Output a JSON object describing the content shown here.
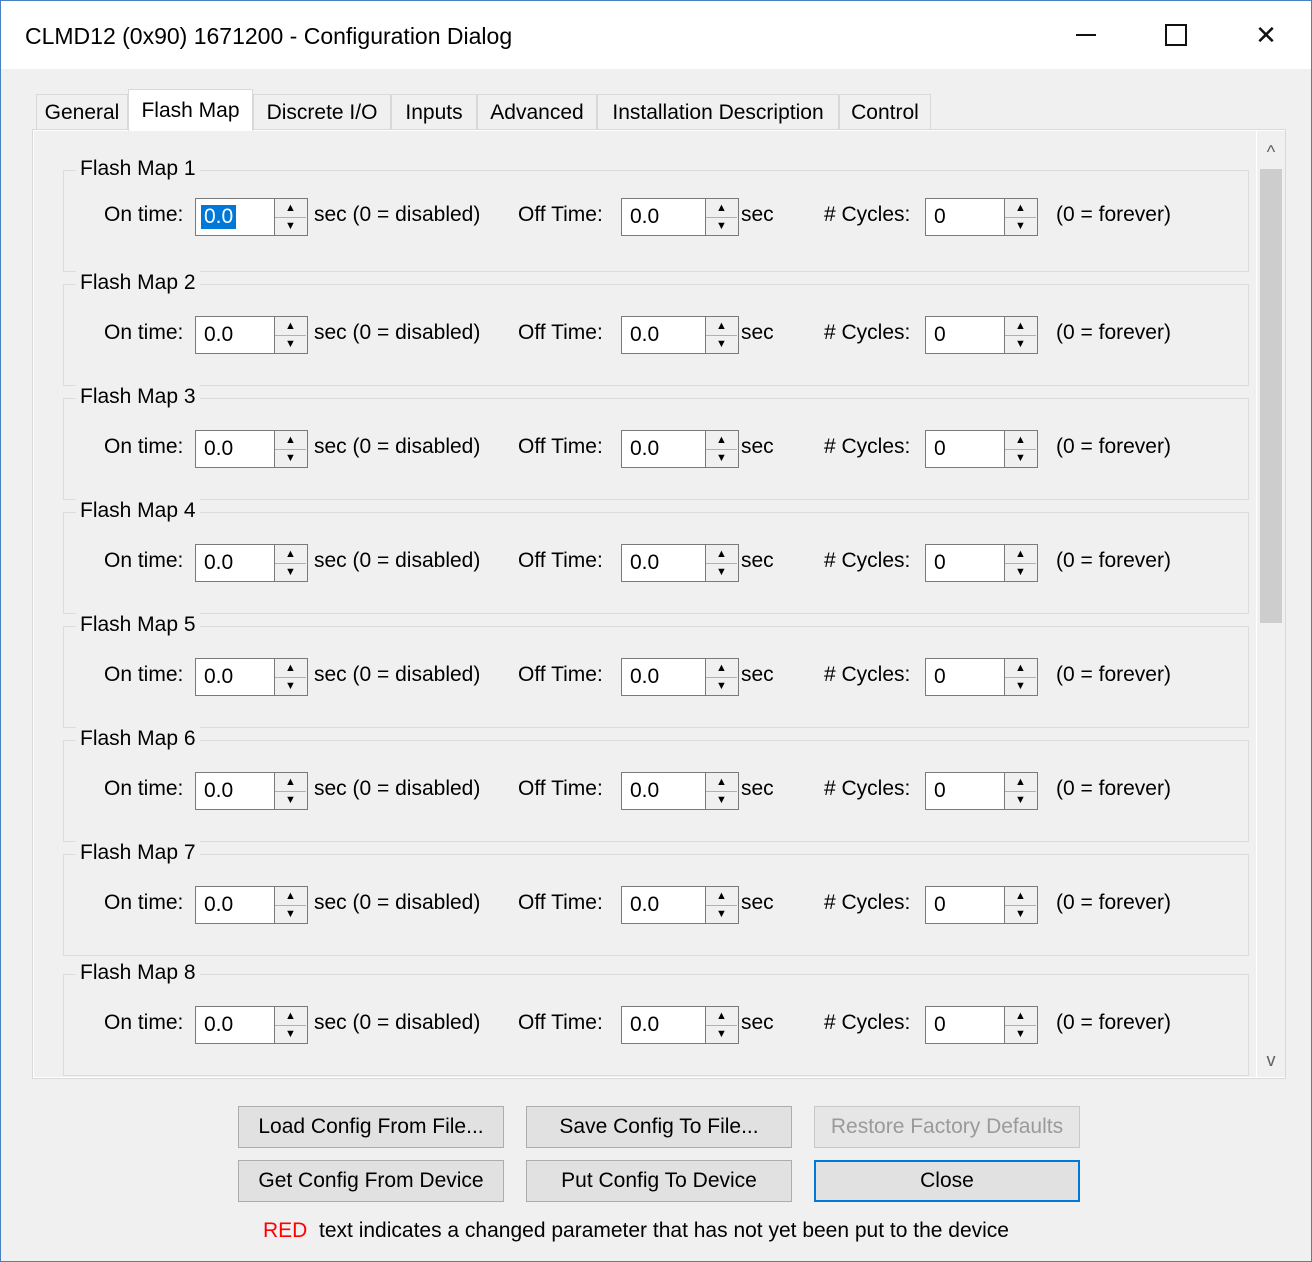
{
  "window": {
    "title": "CLMD12 (0x90) 1671200 - Configuration Dialog",
    "close_glyph": "✕"
  },
  "tabs": [
    {
      "label": "General"
    },
    {
      "label": "Flash Map"
    },
    {
      "label": "Discrete I/O"
    },
    {
      "label": "Inputs"
    },
    {
      "label": "Advanced"
    },
    {
      "label": "Installation Description"
    },
    {
      "label": "Control"
    }
  ],
  "active_tab": "Flash Map",
  "labels": {
    "on_time": "On time:",
    "sec_disabled": "sec  (0 = disabled)",
    "off_time": "Off Time:",
    "sec": "sec",
    "cycles": "# Cycles:",
    "forever": "(0 = forever)"
  },
  "flash_maps": [
    {
      "title": "Flash Map 1",
      "on_time": "0.0",
      "off_time": "0.0",
      "cycles": "0"
    },
    {
      "title": "Flash Map 2",
      "on_time": "0.0",
      "off_time": "0.0",
      "cycles": "0"
    },
    {
      "title": "Flash Map 3",
      "on_time": "0.0",
      "off_time": "0.0",
      "cycles": "0"
    },
    {
      "title": "Flash Map 4",
      "on_time": "0.0",
      "off_time": "0.0",
      "cycles": "0"
    },
    {
      "title": "Flash Map 5",
      "on_time": "0.0",
      "off_time": "0.0",
      "cycles": "0"
    },
    {
      "title": "Flash Map 6",
      "on_time": "0.0",
      "off_time": "0.0",
      "cycles": "0"
    },
    {
      "title": "Flash Map 7",
      "on_time": "0.0",
      "off_time": "0.0",
      "cycles": "0"
    },
    {
      "title": "Flash Map 8",
      "on_time": "0.0",
      "off_time": "0.0",
      "cycles": "0"
    }
  ],
  "scroll": {
    "up_glyph": "^",
    "down_glyph": "v"
  },
  "buttons": {
    "load": "Load Config From File...",
    "save": "Save Config To File...",
    "restore": "Restore Factory Defaults",
    "get": "Get Config From Device",
    "put": "Put Config To Device",
    "close": "Close"
  },
  "footer": {
    "red_word": "RED",
    "note": "text indicates a changed parameter that has not yet been put to the device"
  },
  "colors": {
    "accent": "#0078d7",
    "red_text": "#ff0000",
    "border": "#4a7fc4"
  }
}
